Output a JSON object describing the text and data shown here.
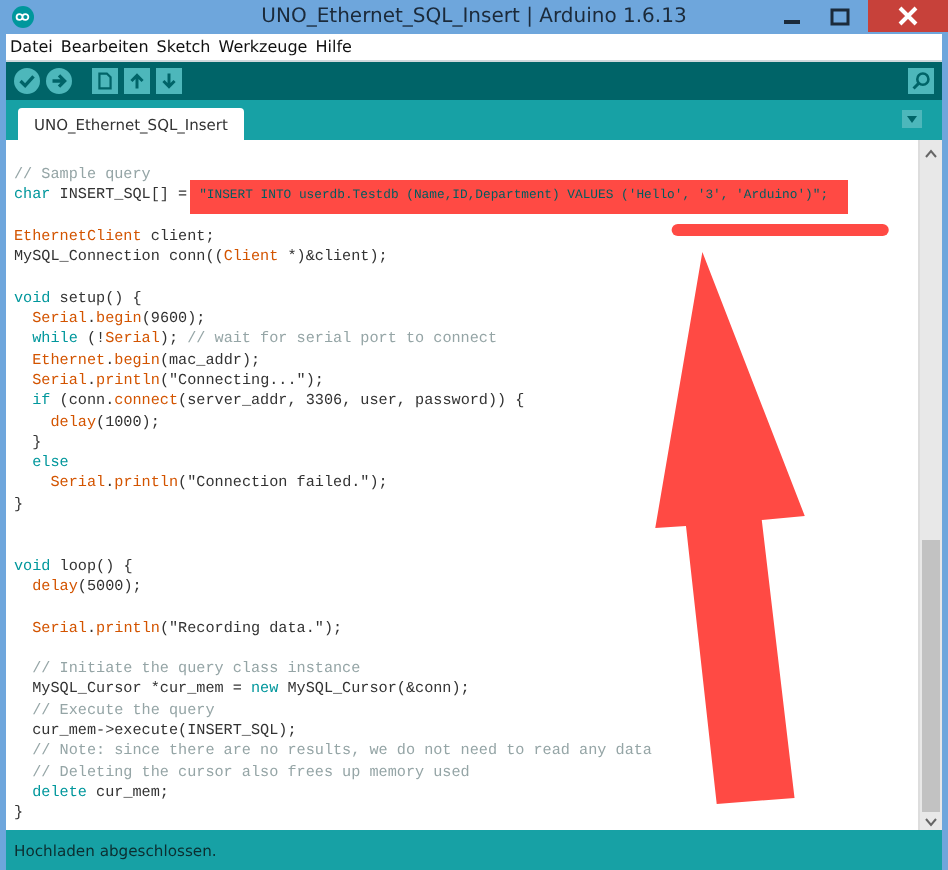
{
  "window": {
    "title": "UNO_Ethernet_SQL_Insert | Arduino 1.6.13"
  },
  "menu": [
    "Datei",
    "Bearbeiten",
    "Sketch",
    "Werkzeuge",
    "Hilfe"
  ],
  "tabs": [
    {
      "label": "UNO_Ethernet_SQL_Insert",
      "selected": true
    }
  ],
  "code": [
    {
      "kind": "code",
      "tokens": [
        {
          "kind": "comment",
          "text": "// Sample query"
        }
      ]
    },
    {
      "kind": "code",
      "tokens": [
        {
          "kind": "keyword",
          "text": "char"
        },
        {
          "kind": "plain",
          "text": " INSERT_SQL[] ="
        },
        {
          "kind": "string",
          "text": "\"INSERT INTO userdb.Testdb (Name,ID,Department) VALUES ('Hello', '3', 'Arduino')\";",
          "highlighted": true
        }
      ]
    },
    {
      "kind": "blank"
    },
    {
      "kind": "code",
      "tokens": [
        {
          "kind": "type",
          "text": "EthernetClient"
        },
        {
          "kind": "plain",
          "text": " client;"
        }
      ]
    },
    {
      "kind": "code",
      "tokens": [
        {
          "kind": "plain",
          "text": "MySQL_Connection conn(("
        },
        {
          "kind": "type",
          "text": "Client"
        },
        {
          "kind": "plain",
          "text": " *)&client);"
        }
      ]
    },
    {
      "kind": "blank"
    },
    {
      "kind": "code",
      "tokens": [
        {
          "kind": "keyword",
          "text": "void"
        },
        {
          "kind": "plain",
          "text": " setup() {"
        }
      ]
    },
    {
      "kind": "code",
      "tokens": [
        {
          "kind": "type",
          "text": "  Serial"
        },
        {
          "kind": "plain",
          "text": "."
        },
        {
          "kind": "type",
          "text": "begin"
        },
        {
          "kind": "plain",
          "text": "(9600);"
        }
      ]
    },
    {
      "kind": "code",
      "tokens": [
        {
          "kind": "keyword",
          "text": "  while"
        },
        {
          "kind": "plain",
          "text": " (!"
        },
        {
          "kind": "type",
          "text": "Serial"
        },
        {
          "kind": "plain",
          "text": "); "
        },
        {
          "kind": "comment",
          "text": "// wait for serial port to connect"
        }
      ]
    },
    {
      "kind": "code",
      "tokens": [
        {
          "kind": "type",
          "text": "  Ethernet"
        },
        {
          "kind": "plain",
          "text": "."
        },
        {
          "kind": "type",
          "text": "begin"
        },
        {
          "kind": "plain",
          "text": "(mac_addr);"
        }
      ]
    },
    {
      "kind": "code",
      "tokens": [
        {
          "kind": "type",
          "text": "  Serial"
        },
        {
          "kind": "plain",
          "text": "."
        },
        {
          "kind": "type",
          "text": "println"
        },
        {
          "kind": "plain",
          "text": "(\"Connecting...\");"
        }
      ]
    },
    {
      "kind": "code",
      "tokens": [
        {
          "kind": "keyword",
          "text": "  if"
        },
        {
          "kind": "plain",
          "text": " (conn."
        },
        {
          "kind": "type",
          "text": "connect"
        },
        {
          "kind": "plain",
          "text": "(server_addr, 3306, user, password)) {"
        }
      ]
    },
    {
      "kind": "code",
      "tokens": [
        {
          "kind": "type",
          "text": "    delay"
        },
        {
          "kind": "plain",
          "text": "(1000);"
        }
      ]
    },
    {
      "kind": "code",
      "tokens": [
        {
          "kind": "plain",
          "text": "  }"
        }
      ]
    },
    {
      "kind": "code",
      "tokens": [
        {
          "kind": "keyword",
          "text": "  else"
        }
      ]
    },
    {
      "kind": "code",
      "tokens": [
        {
          "kind": "type",
          "text": "    Serial"
        },
        {
          "kind": "plain",
          "text": "."
        },
        {
          "kind": "type",
          "text": "println"
        },
        {
          "kind": "plain",
          "text": "(\"Connection failed.\");"
        }
      ]
    },
    {
      "kind": "code",
      "tokens": [
        {
          "kind": "plain",
          "text": "}"
        }
      ]
    },
    {
      "kind": "blank"
    },
    {
      "kind": "blank"
    },
    {
      "kind": "code",
      "tokens": [
        {
          "kind": "keyword",
          "text": "void"
        },
        {
          "kind": "plain",
          "text": " loop() {"
        }
      ]
    },
    {
      "kind": "code",
      "tokens": [
        {
          "kind": "type",
          "text": "  delay"
        },
        {
          "kind": "plain",
          "text": "(5000);"
        }
      ]
    },
    {
      "kind": "blank"
    },
    {
      "kind": "code",
      "tokens": [
        {
          "kind": "type",
          "text": "  Serial"
        },
        {
          "kind": "plain",
          "text": "."
        },
        {
          "kind": "type",
          "text": "println"
        },
        {
          "kind": "plain",
          "text": "(\"Recording data.\");"
        }
      ]
    },
    {
      "kind": "blank"
    },
    {
      "kind": "code",
      "tokens": [
        {
          "kind": "comment",
          "text": "  // Initiate the query class instance"
        }
      ]
    },
    {
      "kind": "code",
      "tokens": [
        {
          "kind": "plain",
          "text": "  MySQL_Cursor *cur_mem = "
        },
        {
          "kind": "keyword",
          "text": "new"
        },
        {
          "kind": "plain",
          "text": " MySQL_Cursor(&conn);"
        }
      ]
    },
    {
      "kind": "code",
      "tokens": [
        {
          "kind": "comment",
          "text": "  // Execute the query"
        }
      ]
    },
    {
      "kind": "code",
      "tokens": [
        {
          "kind": "plain",
          "text": "  cur_mem->execute(INSERT_SQL);"
        }
      ]
    },
    {
      "kind": "code",
      "tokens": [
        {
          "kind": "comment",
          "text": "  // Note: since there are no results, we do not need to read any data"
        }
      ]
    },
    {
      "kind": "code",
      "tokens": [
        {
          "kind": "comment",
          "text": "  // Deleting the cursor also frees up memory used"
        }
      ]
    },
    {
      "kind": "code",
      "tokens": [
        {
          "kind": "keyword",
          "text": "  delete"
        },
        {
          "kind": "plain",
          "text": " cur_mem;"
        }
      ]
    },
    {
      "kind": "code",
      "tokens": [
        {
          "kind": "plain",
          "text": "}"
        }
      ]
    }
  ],
  "status_bar": {
    "message": "Hochladen abgeschlossen."
  }
}
